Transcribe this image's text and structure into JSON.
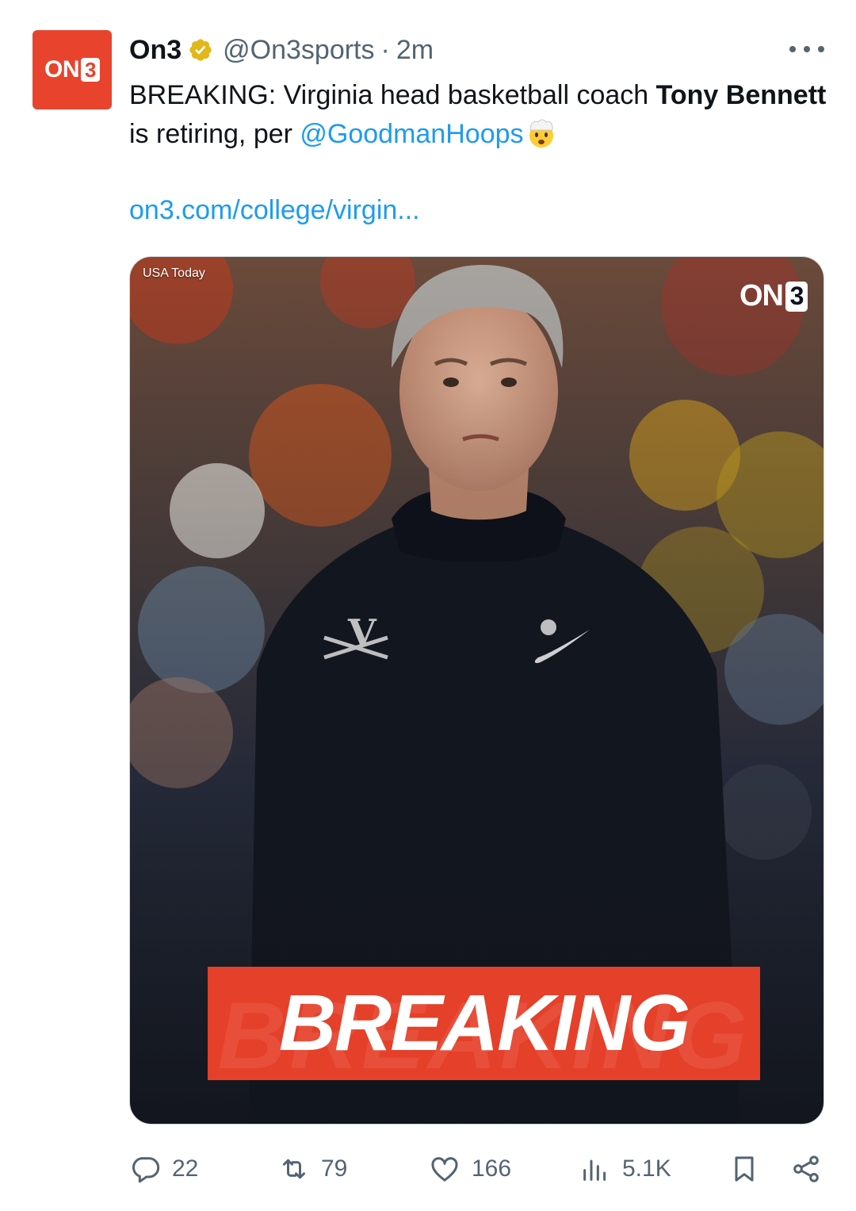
{
  "tweet": {
    "avatar_text": "ON",
    "avatar_box": "3",
    "display_name": "On3",
    "handle": "@On3sports",
    "separator": "·",
    "time": "2m",
    "text_prefix": "BREAKING: Virginia head basketball coach ",
    "text_bold": "Tony Bennett",
    "text_middle": " is retiring, per ",
    "mention": "@GoodmanHoops",
    "link": "on3.com/college/virgin...",
    "emoji": "exploding-head-emoji"
  },
  "media": {
    "credit": "USA Today",
    "logo_text": "ON",
    "logo_box": "3",
    "banner_text": "BREAKING",
    "banner_color": "#e5402a"
  },
  "actions": {
    "replies": "22",
    "reposts": "79",
    "likes": "166",
    "views": "5.1K"
  },
  "colors": {
    "accent": "#1d9bf0",
    "secondary_text": "#536471",
    "brand": "#e8432d",
    "verified_badge": "#e2b719"
  }
}
